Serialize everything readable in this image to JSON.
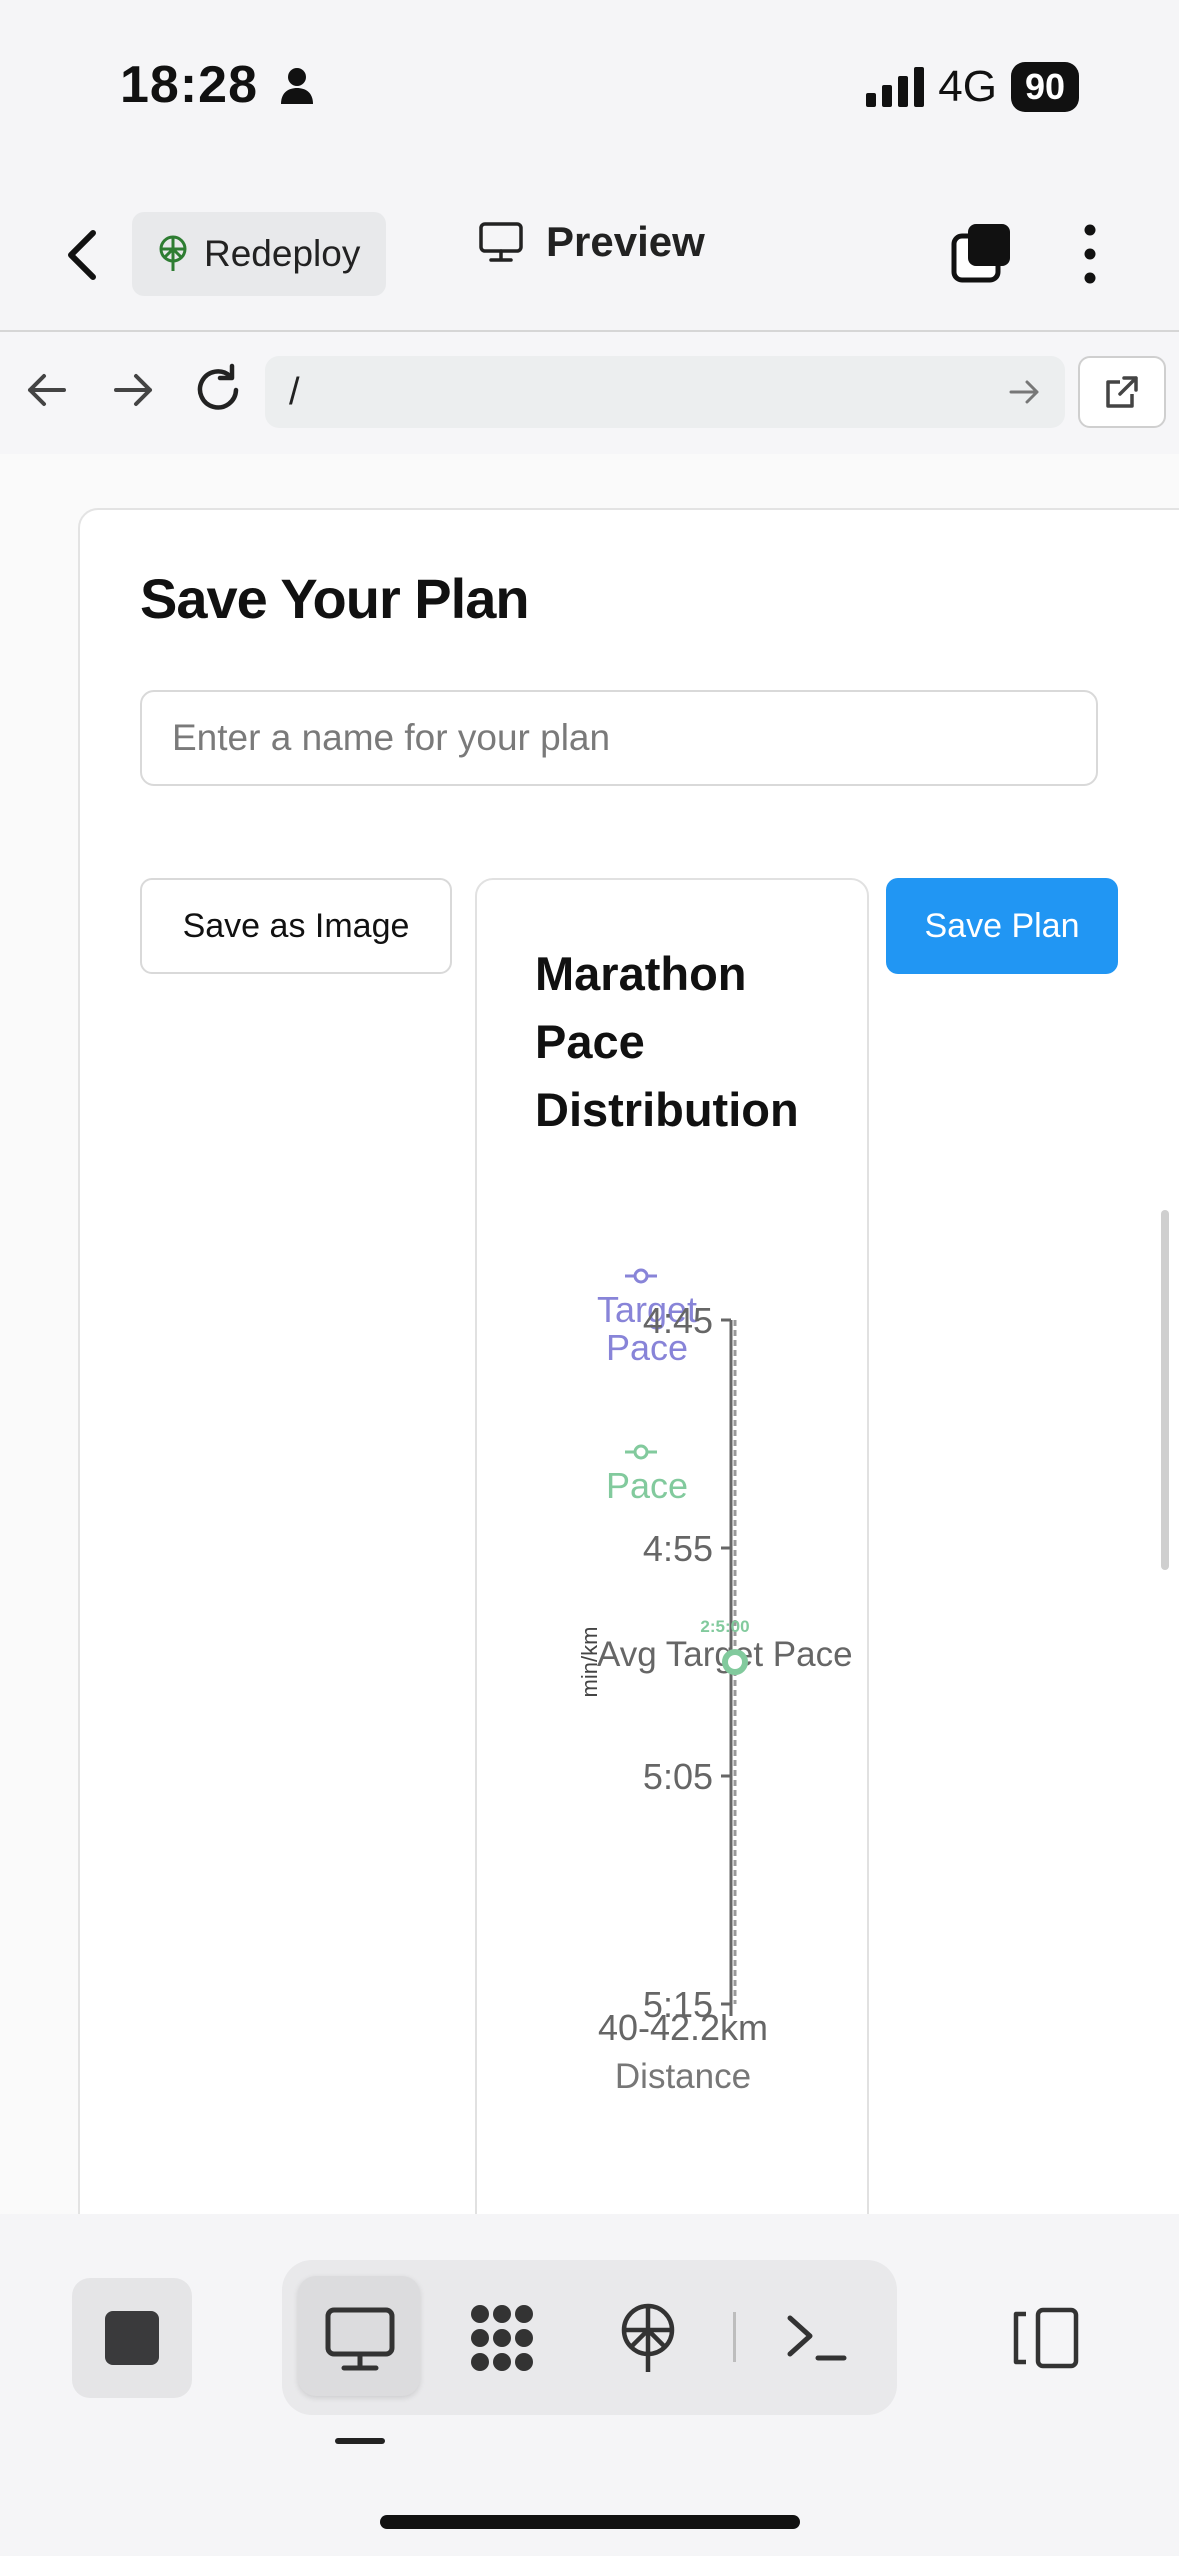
{
  "status": {
    "time": "18:28",
    "network": "4G",
    "battery": "90"
  },
  "appbar": {
    "redeploy_label": "Redeploy",
    "preview_label": "Preview"
  },
  "address": {
    "url": "/"
  },
  "plan": {
    "title": "Save Your Plan",
    "name_placeholder": "Enter a name for your plan",
    "save_image_label": "Save as Image",
    "save_plan_label": "Save Plan"
  },
  "chart_data": {
    "type": "line",
    "title": "Marathon Pace Distribution",
    "xlabel": "Distance",
    "ylabel": "min/km",
    "x_categories": [
      "40-42.2km"
    ],
    "y_ticks": [
      "4:45",
      "4:55",
      "5:05",
      "5:15"
    ],
    "ylim": [
      "4:45",
      "5:15"
    ],
    "legend": [
      "Target Pace",
      "Pace"
    ],
    "legend_colors": [
      "#8884d8",
      "#82ca9d"
    ],
    "reference_line_label": "Avg Target Pace",
    "point_labels": "2:5:00",
    "series": [
      {
        "name": "Pace",
        "color": "#82ca9d",
        "x": [
          "40-42.2km"
        ],
        "y": [
          "5:00"
        ]
      }
    ]
  }
}
